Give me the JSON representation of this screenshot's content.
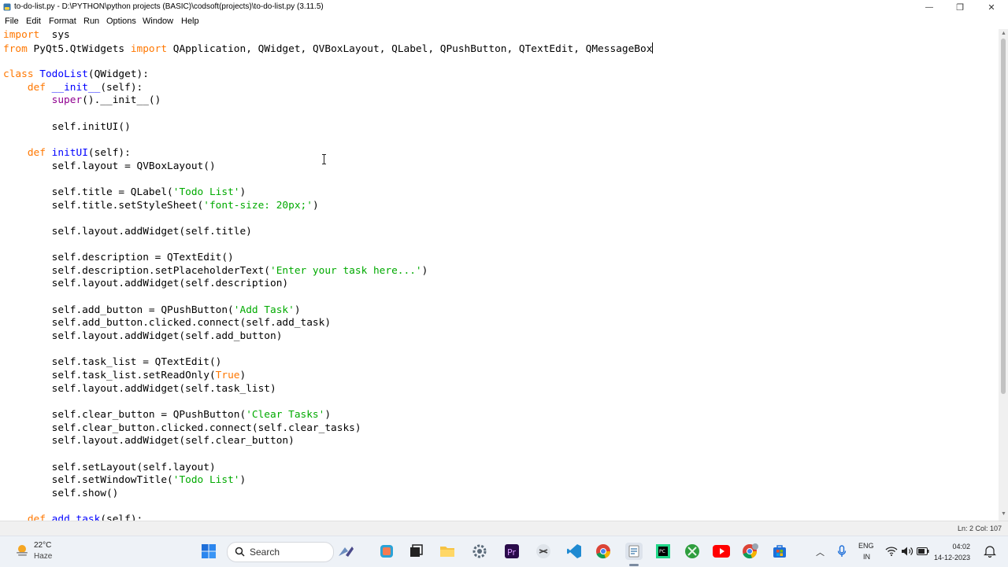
{
  "window": {
    "title": "to-do-list.py - D:\\PYTHON\\python projects (BASIC)\\codsoft(projects)\\to-do-list.py (3.11.5)",
    "minimize_glyph": "—",
    "maximize_glyph": "❐",
    "close_glyph": "✕"
  },
  "menu": [
    "File",
    "Edit",
    "Format",
    "Run",
    "Options",
    "Window",
    "Help"
  ],
  "code_lines": [
    [
      [
        "kw",
        "import"
      ],
      [
        "",
        "  sys"
      ]
    ],
    [
      [
        "kw",
        "from"
      ],
      [
        "",
        " PyQt5.QtWidgets "
      ],
      [
        "kw",
        "import"
      ],
      [
        "",
        " QApplication, QWidget, QVBoxLayout, QLabel, QPushButton, QTextEdit, QMessageBox"
      ],
      [
        "caret",
        ""
      ]
    ],
    [],
    [
      [
        "kw",
        "class"
      ],
      [
        "",
        " "
      ],
      [
        "def",
        "TodoList"
      ],
      [
        "",
        "(QWidget):"
      ]
    ],
    [
      [
        "",
        "    "
      ],
      [
        "kw",
        "def"
      ],
      [
        "",
        " "
      ],
      [
        "def",
        "__init__"
      ],
      [
        "",
        "(self):"
      ]
    ],
    [
      [
        "",
        "        "
      ],
      [
        "bi",
        "super"
      ],
      [
        "",
        "().__init__()"
      ]
    ],
    [],
    [
      [
        "",
        "        self.initUI()"
      ]
    ],
    [],
    [
      [
        "",
        "    "
      ],
      [
        "kw",
        "def"
      ],
      [
        "",
        " "
      ],
      [
        "def",
        "initUI"
      ],
      [
        "",
        "(self):"
      ]
    ],
    [
      [
        "",
        "        self.layout = QVBoxLayout()"
      ]
    ],
    [],
    [
      [
        "",
        "        self.title = QLabel("
      ],
      [
        "str",
        "'Todo List'"
      ],
      [
        "",
        ")"
      ]
    ],
    [
      [
        "",
        "        self.title.setStyleSheet("
      ],
      [
        "str",
        "'font-size: 20px;'"
      ],
      [
        "",
        ")"
      ]
    ],
    [],
    [
      [
        "",
        "        self.layout.addWidget(self.title)"
      ]
    ],
    [],
    [
      [
        "",
        "        self.description = QTextEdit()"
      ]
    ],
    [
      [
        "",
        "        self.description.setPlaceholderText("
      ],
      [
        "str",
        "'Enter your task here...'"
      ],
      [
        "",
        ")"
      ]
    ],
    [
      [
        "",
        "        self.layout.addWidget(self.description)"
      ]
    ],
    [],
    [
      [
        "",
        "        self.add_button = QPushButton("
      ],
      [
        "str",
        "'Add Task'"
      ],
      [
        "",
        ")"
      ]
    ],
    [
      [
        "",
        "        self.add_button.clicked.connect(self.add_task)"
      ]
    ],
    [
      [
        "",
        "        self.layout.addWidget(self.add_button)"
      ]
    ],
    [],
    [
      [
        "",
        "        self.task_list = QTextEdit()"
      ]
    ],
    [
      [
        "",
        "        self.task_list.setReadOnly("
      ],
      [
        "kw",
        "True"
      ],
      [
        "",
        ")"
      ]
    ],
    [
      [
        "",
        "        self.layout.addWidget(self.task_list)"
      ]
    ],
    [],
    [
      [
        "",
        "        self.clear_button = QPushButton("
      ],
      [
        "str",
        "'Clear Tasks'"
      ],
      [
        "",
        ")"
      ]
    ],
    [
      [
        "",
        "        self.clear_button.clicked.connect(self.clear_tasks)"
      ]
    ],
    [
      [
        "",
        "        self.layout.addWidget(self.clear_button)"
      ]
    ],
    [],
    [
      [
        "",
        "        self.setLayout(self.layout)"
      ]
    ],
    [
      [
        "",
        "        self.setWindowTitle("
      ],
      [
        "str",
        "'Todo List'"
      ],
      [
        "",
        ")"
      ]
    ],
    [
      [
        "",
        "        self.show()"
      ]
    ],
    [],
    [
      [
        "",
        "    "
      ],
      [
        "kw",
        "def"
      ],
      [
        "",
        " "
      ],
      [
        "def",
        "add_task"
      ],
      [
        "",
        "(self):"
      ]
    ]
  ],
  "status": {
    "position": "Ln: 2   Col: 107"
  },
  "taskbar": {
    "weather_temp": "22°C",
    "weather_desc": "Haze",
    "search_label": "Search",
    "lang_top": "ENG",
    "lang_bottom": "IN",
    "time": "04:02",
    "date": "14-12-2023"
  },
  "colors": {
    "keyword": "#ff7700",
    "builtin": "#900090",
    "definition": "#0000ff",
    "string": "#00aa00"
  },
  "taskbar_icons": [
    "windows-start-icon",
    "search-icon",
    "widgets-icon",
    "copilot-icon",
    "task-view-icon",
    "file-explorer-icon",
    "settings-icon",
    "premiere-icon",
    "capcut-icon",
    "vscode-icon",
    "chrome-icon",
    "idle-python-icon",
    "pycharm-icon",
    "xbox-icon",
    "youtube-icon",
    "chrome-profile-icon",
    "store-icon"
  ]
}
